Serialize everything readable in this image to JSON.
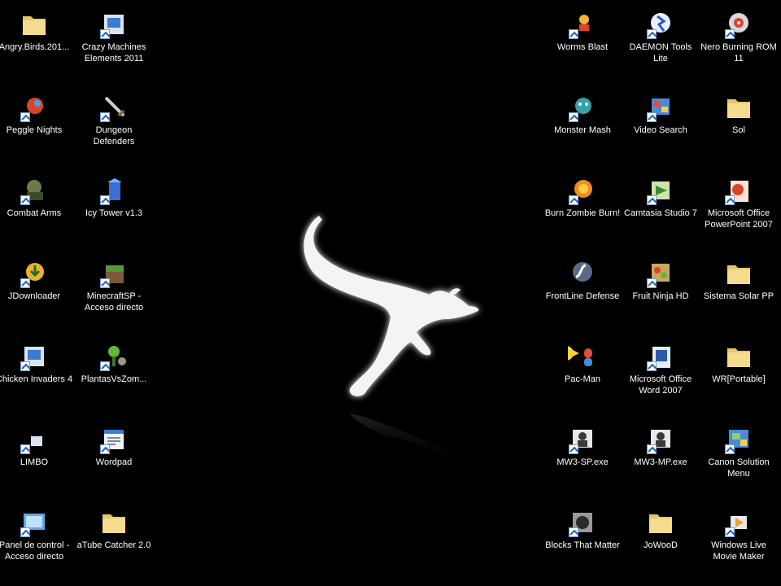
{
  "desktop": {
    "icons_left": [
      {
        "label": "Angry.Birds.201...",
        "icon": "folder-icon"
      },
      {
        "label": "Crazy Machines Elements 2011",
        "icon": "app-icon"
      },
      {
        "label": "Peggle Nights",
        "icon": "game-icon"
      },
      {
        "label": "Dungeon Defenders",
        "icon": "sword-icon"
      },
      {
        "label": "Combat Arms",
        "icon": "game-icon"
      },
      {
        "label": "Icy Tower v1.3",
        "icon": "tower-icon"
      },
      {
        "label": "JDownloader",
        "icon": "download-icon"
      },
      {
        "label": "MinecraftSP - Acceso directo",
        "icon": "minecraft-icon"
      },
      {
        "label": "Chicken Invaders 4",
        "icon": "app-icon"
      },
      {
        "label": "PlantasVsZom...",
        "icon": "plant-icon"
      },
      {
        "label": "LIMBO",
        "icon": "app-icon"
      },
      {
        "label": "Wordpad",
        "icon": "wordpad-icon"
      },
      {
        "label": "Panel de control - Acceso directo",
        "icon": "control-panel-icon"
      },
      {
        "label": "aTube Catcher 2.0",
        "icon": "folder-icon"
      }
    ],
    "icons_right": [
      {
        "label": "Worms Blast",
        "icon": "game-icon"
      },
      {
        "label": "DAEMON Tools Lite",
        "icon": "daemon-icon"
      },
      {
        "label": "Nero Burning ROM 11",
        "icon": "nero-icon"
      },
      {
        "label": "Monster Mash",
        "icon": "game-icon"
      },
      {
        "label": "Video Search",
        "icon": "video-icon"
      },
      {
        "label": "Sol",
        "icon": "folder-icon"
      },
      {
        "label": "Burn Zombie Burn!",
        "icon": "zombie-icon"
      },
      {
        "label": "Camtasia Studio 7",
        "icon": "camtasia-icon"
      },
      {
        "label": "Microsoft Office PowerPoint 2007",
        "icon": "powerpoint-icon"
      },
      {
        "label": "FrontLine Defense",
        "icon": "flash-icon"
      },
      {
        "label": "Fruit Ninja HD",
        "icon": "fruit-icon"
      },
      {
        "label": "Sistema Solar PP",
        "icon": "folder-icon"
      },
      {
        "label": "Pac-Man",
        "icon": "pacman-icon"
      },
      {
        "label": "Microsoft Office Word 2007",
        "icon": "word-icon"
      },
      {
        "label": "WR[Portable]",
        "icon": "folder-icon"
      },
      {
        "label": "MW3-SP.exe",
        "icon": "soldier-icon"
      },
      {
        "label": "MW3-MP.exe",
        "icon": "soldier-icon"
      },
      {
        "label": "Canon Solution Menu",
        "icon": "printer-icon"
      },
      {
        "label": "Blocks That Matter",
        "icon": "game-icon"
      },
      {
        "label": "JoWooD",
        "icon": "folder-icon"
      },
      {
        "label": "Windows Live Movie Maker",
        "icon": "movie-maker-icon"
      }
    ]
  },
  "colors": {
    "background": "#000000",
    "label_text": "#ffffff",
    "wallpaper_logo": "#f4f4f4"
  }
}
